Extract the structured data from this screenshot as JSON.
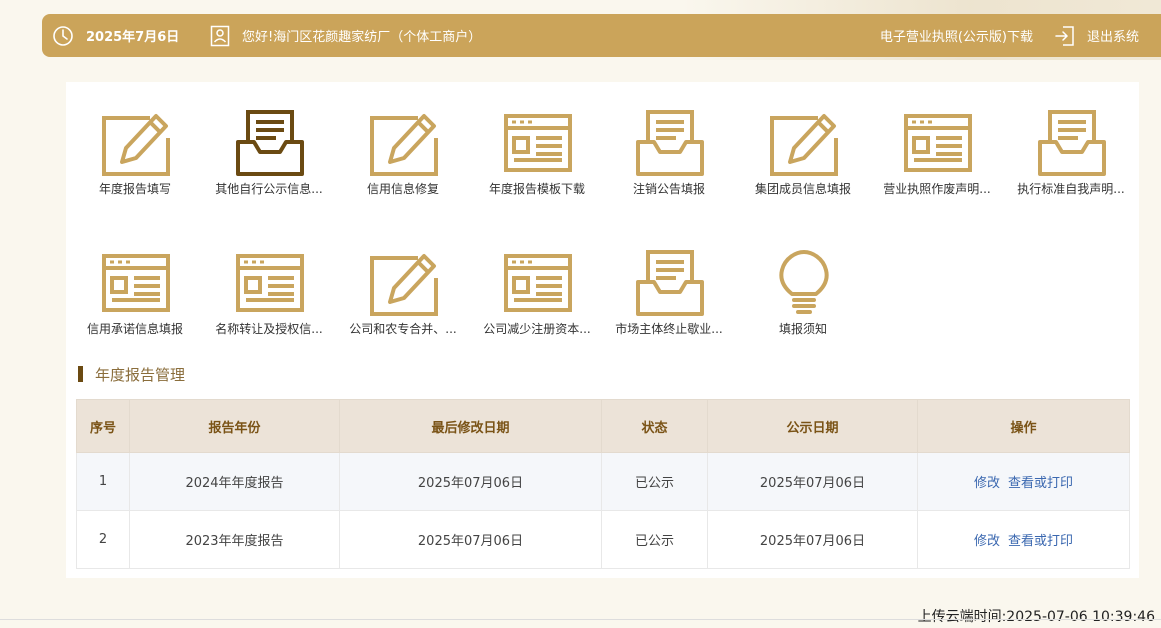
{
  "header": {
    "date": "2025年7月6日",
    "greeting": "您好!海门区花颜趣家纺厂（个体工商户）",
    "license_download": "电子营业执照(公示版)下载",
    "logout": "退出系统"
  },
  "colors": {
    "gold": "#cba45a",
    "brown": "#6b4a12",
    "link": "#3b68b0"
  },
  "tiles": [
    {
      "label": "年度报告填写",
      "icon": "pencil-doc-icon"
    },
    {
      "label": "其他自行公示信息...",
      "icon": "inbox-doc-icon"
    },
    {
      "label": "信用信息修复",
      "icon": "pencil-doc-icon"
    },
    {
      "label": "年度报告模板下载",
      "icon": "window-doc-icon"
    },
    {
      "label": "注销公告填报",
      "icon": "inbox-doc-icon"
    },
    {
      "label": "集团成员信息填报",
      "icon": "pencil-doc-icon"
    },
    {
      "label": "营业执照作废声明...",
      "icon": "window-doc-icon"
    },
    {
      "label": "执行标准自我声明...",
      "icon": "inbox-doc-icon"
    },
    {
      "label": "信用承诺信息填报",
      "icon": "window-doc-icon"
    },
    {
      "label": "名称转让及授权信...",
      "icon": "window-doc-icon"
    },
    {
      "label": "公司和农专合并、...",
      "icon": "pencil-doc-icon"
    },
    {
      "label": "公司减少注册资本...",
      "icon": "window-doc-icon"
    },
    {
      "label": "市场主体终止歇业...",
      "icon": "inbox-doc-icon"
    },
    {
      "label": "填报须知",
      "icon": "lightbulb-icon"
    }
  ],
  "section": {
    "title": "年度报告管理"
  },
  "table": {
    "headers": [
      "序号",
      "报告年份",
      "最后修改日期",
      "状态",
      "公示日期",
      "操作"
    ],
    "rows": [
      {
        "no": "1",
        "year": "2024年年度报告",
        "modified": "2025年07月06日",
        "status": "已公示",
        "publish": "2025年07月06日",
        "edit": "修改",
        "view": "查看或打印"
      },
      {
        "no": "2",
        "year": "2023年年度报告",
        "modified": "2025年07月06日",
        "status": "已公示",
        "publish": "2025年07月06日",
        "edit": "修改",
        "view": "查看或打印"
      }
    ]
  },
  "footer": {
    "upload_time": "上传云端时间:2025-07-06 10:39:46"
  }
}
